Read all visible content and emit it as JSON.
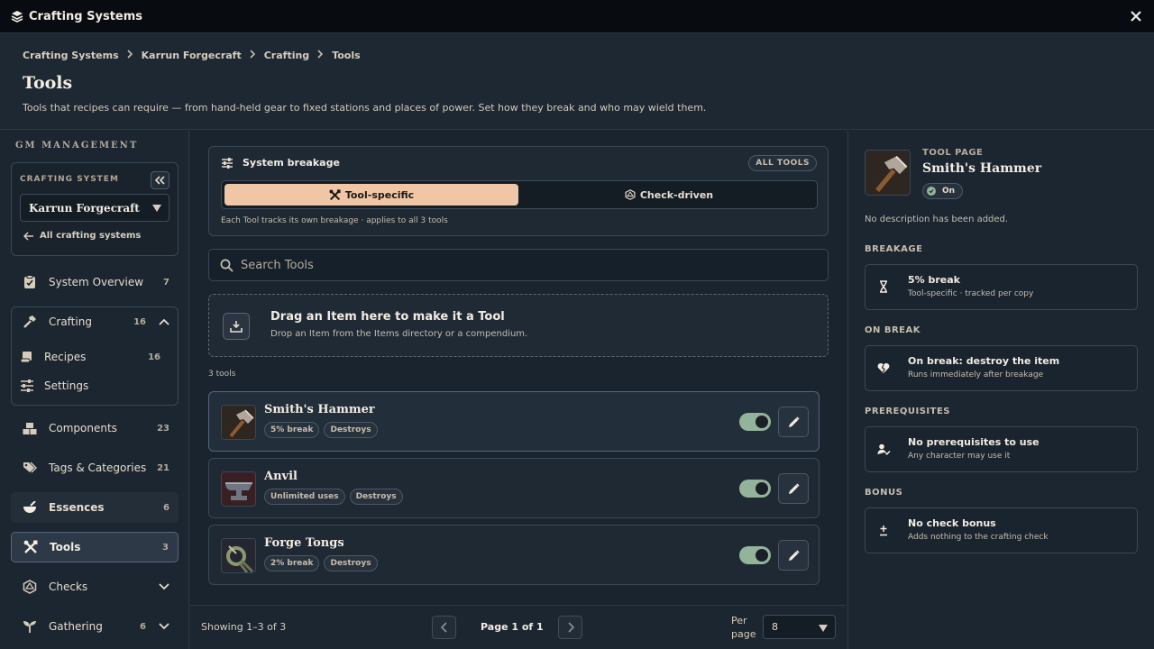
{
  "window": {
    "title": "Crafting Systems"
  },
  "breadcrumb": [
    "Crafting Systems",
    "Karrun Forgecraft",
    "Crafting",
    "Tools"
  ],
  "page": {
    "title": "Tools",
    "subtitle": "Tools that recipes can require — from hand-held gear to fixed stations and places of power. Set how they break and who may wield them."
  },
  "sidebar": {
    "section_label": "GM MANAGEMENT",
    "crafting_system_label": "CRAFTING SYSTEM",
    "selected_system": "Karrun Forgecraft",
    "back_link": "All crafting systems",
    "items": [
      {
        "label": "System Overview",
        "count": "7",
        "icon": "clipboard-icon"
      },
      {
        "label": "Crafting",
        "count": "16",
        "icon": "hammer-icon",
        "expanded": true,
        "children": [
          {
            "label": "Recipes",
            "count": "16",
            "icon": "scroll-icon"
          },
          {
            "label": "Settings",
            "count": "",
            "icon": "sliders-icon"
          }
        ]
      },
      {
        "label": "Components",
        "count": "23",
        "icon": "boxes-icon"
      },
      {
        "label": "Tags & Categories",
        "count": "21",
        "icon": "tags-icon"
      },
      {
        "label": "Essences",
        "count": "6",
        "icon": "mortar-icon"
      },
      {
        "label": "Tools",
        "count": "3",
        "icon": "tools-icon",
        "active": true
      },
      {
        "label": "Checks",
        "count": "",
        "icon": "d20-icon"
      },
      {
        "label": "Gathering",
        "count": "6",
        "icon": "sprout-icon"
      }
    ]
  },
  "breakage": {
    "title": "System breakage",
    "scope_badge": "ALL TOOLS",
    "options": [
      "Tool-specific",
      "Check-driven"
    ],
    "selected": "Tool-specific",
    "note": "Each Tool tracks its own breakage · applies to all 3 tools"
  },
  "search": {
    "placeholder": "Search Tools",
    "value": ""
  },
  "dropzone": {
    "title": "Drag an Item here to make it a Tool",
    "subtitle": "Drop an Item from the Items directory or a compendium."
  },
  "tools_count": "3 tools",
  "tools": [
    {
      "name": "Smith's Hammer",
      "tags": [
        "5% break",
        "Destroys"
      ],
      "enabled": true,
      "selected": true
    },
    {
      "name": "Anvil",
      "tags": [
        "Unlimited uses",
        "Destroys"
      ],
      "enabled": true,
      "selected": false
    },
    {
      "name": "Forge Tongs",
      "tags": [
        "2% break",
        "Destroys"
      ],
      "enabled": true,
      "selected": false
    }
  ],
  "pagination": {
    "showing": "Showing 1–3 of 3",
    "page_text": "Page 1 of 1",
    "per_page_label": "Per page",
    "per_page_value": "8"
  },
  "detail": {
    "kicker": "TOOL PAGE",
    "name": "Smith's Hammer",
    "status": "On",
    "description": "No description has been added.",
    "sections": [
      {
        "heading": "BREAKAGE",
        "title": "5% break",
        "sub": "Tool-specific · tracked per copy",
        "icon": "hourglass-icon"
      },
      {
        "heading": "ON BREAK",
        "title": "On break: destroy the item",
        "sub": "Runs immediately after breakage",
        "icon": "broken-heart-icon"
      },
      {
        "heading": "PREREQUISITES",
        "title": "No prerequisites to use",
        "sub": "Any character may use it",
        "icon": "user-check-icon"
      },
      {
        "heading": "BONUS",
        "title": "No check bonus",
        "sub": "Adds nothing to the crafting check",
        "icon": "plus-minus-icon"
      }
    ]
  },
  "colors": {
    "accent": "#efc7a6",
    "toggle_on": "#93b39a",
    "background": "#1c2630"
  }
}
